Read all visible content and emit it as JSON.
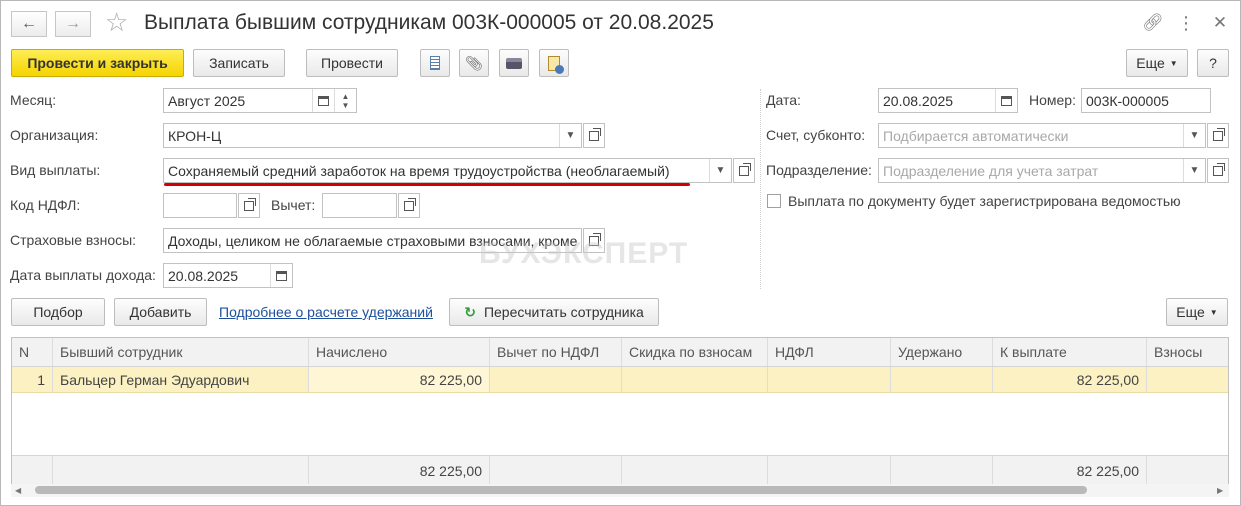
{
  "window": {
    "title": "Выплата бывшим сотрудникам 003К-000005 от 20.08.2025"
  },
  "toolbar": {
    "post_and_close": "Провести и закрыть",
    "save": "Записать",
    "post": "Провести",
    "more": "Еще",
    "help": "?"
  },
  "form": {
    "month_label": "Месяц:",
    "month_value": "Август 2025",
    "org_label": "Организация:",
    "org_value": "КРОН-Ц",
    "payment_type_label": "Вид выплаты:",
    "payment_type_value": "Сохраняемый средний заработок на время трудоустройства (необлагаемый)",
    "ndfl_code_label": "Код НДФЛ:",
    "ndfl_code_value": "",
    "deduction_label": "Вычет:",
    "deduction_value": "",
    "insurance_label": "Страховые взносы:",
    "insurance_value": "Доходы, целиком не облагаемые страховыми взносами, кроме",
    "income_date_label": "Дата выплаты дохода:",
    "income_date_value": "20.08.2025",
    "date_label": "Дата:",
    "date_value": "20.08.2025",
    "number_label": "Номер:",
    "number_value": "003К-000005",
    "account_label": "Счет, субконто:",
    "account_placeholder": "Подбирается автоматически",
    "division_label": "Подразделение:",
    "division_placeholder": "Подразделение для учета затрат",
    "statement_checkbox_label": "Выплата по документу будет зарегистрирована ведомостью",
    "statement_checked": false
  },
  "watermark": "БУХЭКСПЕРТ",
  "table_toolbar": {
    "pick": "Подбор",
    "add": "Добавить",
    "details_link": "Подробнее о расчете удержаний",
    "recalc": "Пересчитать сотрудника",
    "more": "Еще"
  },
  "table": {
    "columns": [
      "N",
      "Бывший сотрудник",
      "Начислено",
      "Вычет по НДФЛ",
      "Скидка по взносам",
      "НДФЛ",
      "Удержано",
      "К выплате",
      "Взносы"
    ],
    "rows": [
      [
        "1",
        "Бальцер Герман Эдуардович",
        "82 225,00",
        "",
        "",
        "",
        "",
        "82 225,00",
        ""
      ]
    ],
    "footer": [
      "",
      "",
      "82 225,00",
      "",
      "",
      "",
      "",
      "82 225,00",
      ""
    ]
  },
  "colors": {
    "primary_button": "#f5d400",
    "selected_row": "#fbf1c3",
    "underline_mark": "#d40000",
    "link": "#1c4f9c",
    "recalc_icon": "#2e9b3a"
  }
}
